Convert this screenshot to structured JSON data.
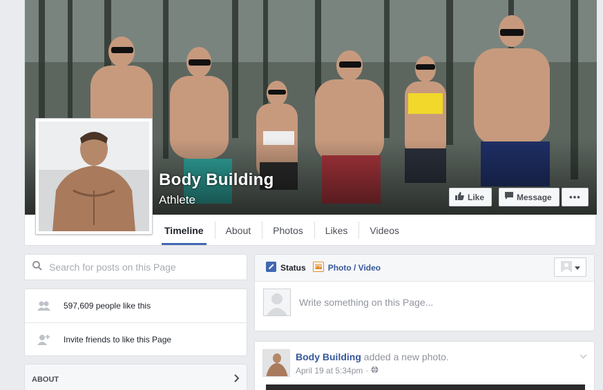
{
  "page": {
    "name": "Body Building",
    "category": "Athlete"
  },
  "header_buttons": {
    "like": "Like",
    "message": "Message",
    "more": "•••"
  },
  "tabs": [
    {
      "label": "Timeline",
      "active": true
    },
    {
      "label": "About"
    },
    {
      "label": "Photos"
    },
    {
      "label": "Likes"
    },
    {
      "label": "Videos"
    }
  ],
  "search": {
    "placeholder": "Search for posts on this Page"
  },
  "stats": {
    "likes": "597,609 people like this",
    "invite": "Invite friends to like this Page"
  },
  "about": {
    "label": "ABOUT"
  },
  "composer": {
    "status_label": "Status",
    "photo_label": "Photo / Video",
    "placeholder": "Write something on this Page..."
  },
  "post": {
    "author": "Body Building",
    "action": "added a new photo.",
    "timestamp": "April 19 at 5:34pm"
  },
  "colors": {
    "link": "#365899",
    "active_tab_underline": "#4267b2",
    "background": "#e9ebee"
  }
}
